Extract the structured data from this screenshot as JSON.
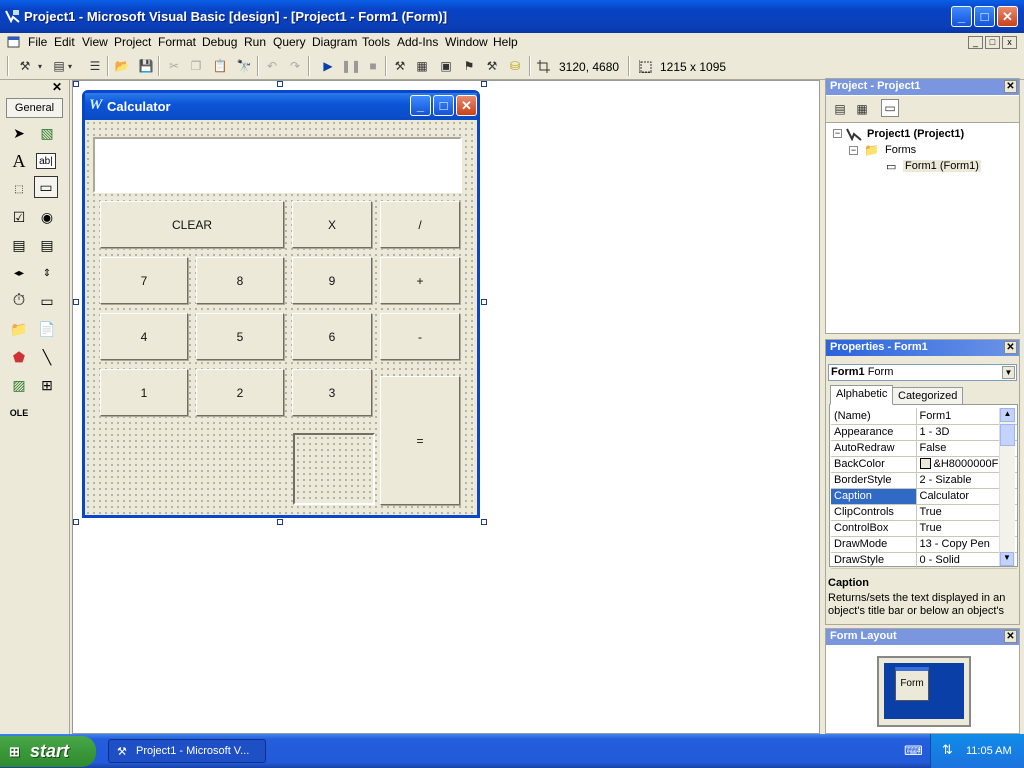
{
  "app": {
    "title": "Project1 - Microsoft Visual Basic [design] - [Project1 - Form1 (Form)]"
  },
  "menu": [
    "File",
    "Edit",
    "View",
    "Project",
    "Format",
    "Debug",
    "Run",
    "Query",
    "Diagram",
    "Tools",
    "Add-Ins",
    "Window",
    "Help"
  ],
  "mdi_controls": [
    "_",
    "□",
    "x"
  ],
  "toolbar": {
    "position": "3120, 4680",
    "size": "1215 x 1095"
  },
  "toolbox": {
    "tab": "General"
  },
  "form": {
    "title": "Calculator",
    "buttons": {
      "clear": "CLEAR",
      "mul": "X",
      "div": "/",
      "b7": "7",
      "b8": "8",
      "b9": "9",
      "plus": "+",
      "b4": "4",
      "b5": "5",
      "b6": "6",
      "minus": "-",
      "b1": "1",
      "b2": "2",
      "b3": "3",
      "eq": "="
    }
  },
  "project_panel": {
    "title": "Project - Project1",
    "root": "Project1 (Project1)",
    "folder": "Forms",
    "item": "Form1 (Form1)"
  },
  "properties_panel": {
    "title": "Properties - Form1",
    "object": "Form1",
    "object_type": "Form",
    "tabs": [
      "Alphabetic",
      "Categorized"
    ],
    "rows": [
      {
        "name": "(Name)",
        "value": "Form1"
      },
      {
        "name": "Appearance",
        "value": "1 - 3D"
      },
      {
        "name": "AutoRedraw",
        "value": "False"
      },
      {
        "name": "BackColor",
        "value": "&H8000000F"
      },
      {
        "name": "BorderStyle",
        "value": "2 - Sizable"
      },
      {
        "name": "Caption",
        "value": "Calculator"
      },
      {
        "name": "ClipControls",
        "value": "True"
      },
      {
        "name": "ControlBox",
        "value": "True"
      },
      {
        "name": "DrawMode",
        "value": "13 - Copy Pen"
      },
      {
        "name": "DrawStyle",
        "value": "0 - Solid"
      }
    ],
    "desc_title": "Caption",
    "desc_text": "Returns/sets the text displayed in an object's title bar or below an object's"
  },
  "layout_panel": {
    "title": "Form Layout",
    "form_label": "Form"
  },
  "taskbar": {
    "start": "start",
    "item": "Project1 - Microsoft V...",
    "clock": "11:05 AM"
  }
}
